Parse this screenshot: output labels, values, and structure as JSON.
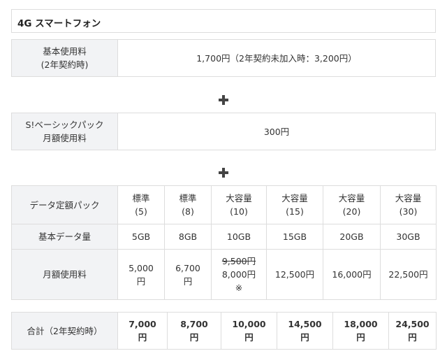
{
  "title": "4G スマートフォン",
  "basic": {
    "label1": "基本使用料",
    "label2": "(2年契約時)",
    "value": "1,700円（2年契約未加入時：3,200円）"
  },
  "sbasic": {
    "label1": "S!ベーシックパック",
    "label2": "月額使用料",
    "value": "300円"
  },
  "plans": {
    "header_label": "データ定額パック",
    "data_label": "基本データ量",
    "fee_label": "月額使用料",
    "columns": [
      {
        "name": "標準",
        "size": "(5)",
        "data": "5GB",
        "fee1": "5,000",
        "fee2": "円"
      },
      {
        "name": "標準",
        "size": "(8)",
        "data": "8GB",
        "fee1": "6,700",
        "fee2": "円"
      },
      {
        "name": "大容量",
        "size": "(10)",
        "data": "10GB",
        "fee_old": "9,500円",
        "fee1": "8,000円",
        "fee2": "※"
      },
      {
        "name": "大容量",
        "size": "(15)",
        "data": "15GB",
        "fee1": "12,500円"
      },
      {
        "name": "大容量",
        "size": "(20)",
        "data": "20GB",
        "fee1": "16,000円"
      },
      {
        "name": "大容量",
        "size": "(30)",
        "data": "30GB",
        "fee1": "22,500円"
      }
    ]
  },
  "total": {
    "label": "合計（2年契約時）",
    "values": [
      {
        "amount": "7,000",
        "unit": "円"
      },
      {
        "amount": "8,700",
        "unit": "円"
      },
      {
        "amount": "10,000",
        "unit": "円"
      },
      {
        "amount": "14,500",
        "unit": "円"
      },
      {
        "amount": "18,000",
        "unit": "円"
      },
      {
        "amount": "24,500",
        "unit": "円"
      }
    ]
  }
}
